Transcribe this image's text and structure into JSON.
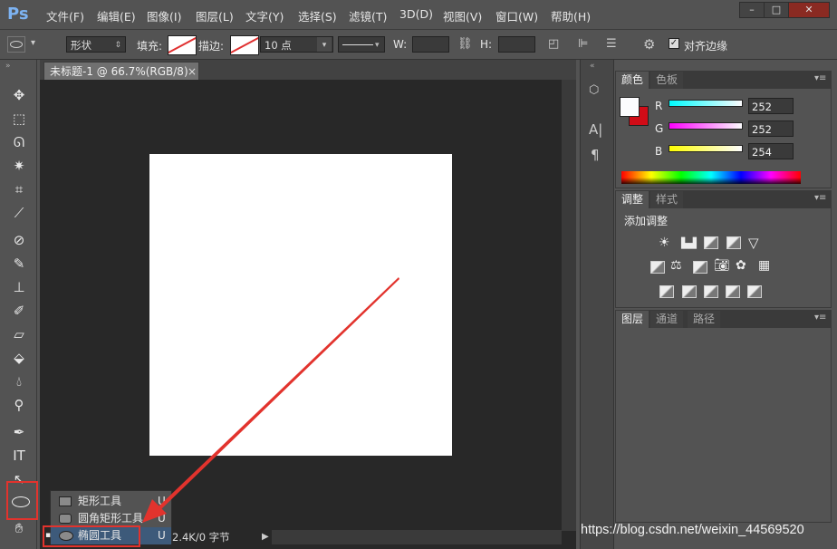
{
  "app": {
    "logo": "Ps"
  },
  "menu": [
    "文件(F)",
    "编辑(E)",
    "图像(I)",
    "图层(L)",
    "文字(Y)",
    "选择(S)",
    "滤镜(T)",
    "3D(D)",
    "视图(V)",
    "窗口(W)",
    "帮助(H)"
  ],
  "window_controls": {
    "minimize": "–",
    "maximize": "□",
    "close": "✕"
  },
  "options": {
    "mode": "形状",
    "fill_label": "填充:",
    "stroke_label": "描边:",
    "stroke_width": "10 点",
    "w_label": "W:",
    "h_label": "H:",
    "align_edges_label": "对齐边缘",
    "align_edges_checked": true
  },
  "document": {
    "tab_title": "未标题-1 @ 66.7%(RGB/8)",
    "status": "2.4K/0 字节"
  },
  "color_panel": {
    "tabs": [
      "颜色",
      "色板"
    ],
    "r_label": "R",
    "g_label": "G",
    "b_label": "B",
    "r": "252",
    "g": "252",
    "b": "254"
  },
  "adjust_panel": {
    "tabs": [
      "调整",
      "样式"
    ],
    "heading": "添加调整"
  },
  "layers_panel": {
    "tabs": [
      "图层",
      "通道",
      "路径"
    ]
  },
  "tool_flyout": {
    "items": [
      {
        "label": "矩形工具",
        "key": "U"
      },
      {
        "label": "圆角矩形工具",
        "key": "U"
      },
      {
        "label": "椭圆工具",
        "key": "U"
      }
    ]
  },
  "annotation": {
    "highlight_color": "#e2332d"
  },
  "watermark": "https://blog.csdn.net/weixin_44569520"
}
